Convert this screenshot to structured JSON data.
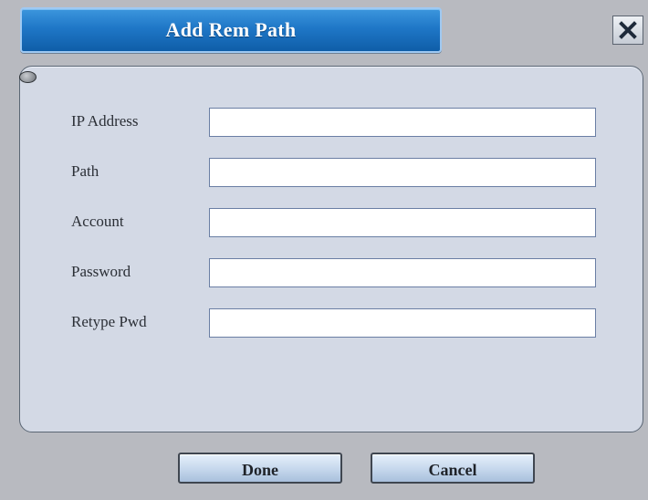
{
  "dialog": {
    "title": "Add Rem Path",
    "close_icon": "close-icon"
  },
  "form": {
    "fields": [
      {
        "label": "IP Address",
        "value": ""
      },
      {
        "label": "Path",
        "value": ""
      },
      {
        "label": "Account",
        "value": ""
      },
      {
        "label": "Password",
        "value": ""
      },
      {
        "label": "Retype Pwd",
        "value": ""
      }
    ]
  },
  "buttons": {
    "done": "Done",
    "cancel": "Cancel"
  },
  "colors": {
    "title_bar": "#1f77c7",
    "panel": "#d3d9e5",
    "dialog_bg": "#b8bac0"
  }
}
